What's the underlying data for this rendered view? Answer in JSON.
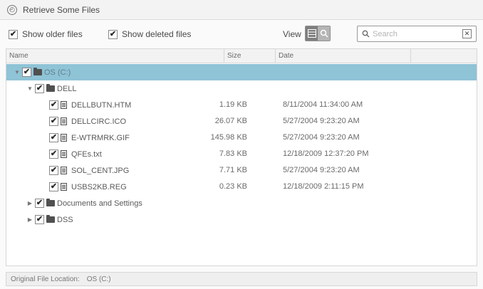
{
  "window": {
    "title": "Retrieve Some Files",
    "title_icon": "clock-icon"
  },
  "toolbar": {
    "show_older": {
      "label": "Show older files",
      "checked": true
    },
    "show_deleted": {
      "label": "Show deleted files",
      "checked": true
    },
    "view_label": "View",
    "view_modes": [
      {
        "name": "list-view-icon",
        "active": true
      },
      {
        "name": "search-view-icon",
        "active": false
      }
    ],
    "search": {
      "placeholder": "Search",
      "value": ""
    }
  },
  "table": {
    "columns": [
      "Name",
      "Size",
      "Date"
    ],
    "rows": [
      {
        "type": "drive",
        "name": "OS (C:)",
        "size": "",
        "date": "",
        "expanded": true,
        "checked": true,
        "selected": true,
        "depth": 0
      },
      {
        "type": "folder",
        "name": "DELL",
        "size": "",
        "date": "",
        "expanded": true,
        "checked": true,
        "selected": false,
        "depth": 1
      },
      {
        "type": "file",
        "name": "DELLBUTN.HTM",
        "size": "1.19 KB",
        "date": "8/11/2004 11:34:00 AM",
        "checked": true,
        "selected": false,
        "depth": 2
      },
      {
        "type": "file",
        "name": "DELLCIRC.ICO",
        "size": "26.07 KB",
        "date": "5/27/2004 9:23:20 AM",
        "checked": true,
        "selected": false,
        "depth": 2
      },
      {
        "type": "file",
        "name": "E-WTRMRK.GIF",
        "size": "145.98 KB",
        "date": "5/27/2004 9:23:20 AM",
        "checked": true,
        "selected": false,
        "depth": 2
      },
      {
        "type": "file",
        "name": "QFEs.txt",
        "size": "7.83 KB",
        "date": "12/18/2009 12:37:20 PM",
        "checked": true,
        "selected": false,
        "depth": 2
      },
      {
        "type": "file",
        "name": "SOL_CENT.JPG",
        "size": "7.71 KB",
        "date": "5/27/2004 9:23:20 AM",
        "checked": true,
        "selected": false,
        "depth": 2
      },
      {
        "type": "file",
        "name": "USBS2KB.REG",
        "size": "0.23 KB",
        "date": "12/18/2009 2:11:15 PM",
        "checked": true,
        "selected": false,
        "depth": 2
      },
      {
        "type": "folder",
        "name": "Documents and Settings",
        "size": "",
        "date": "",
        "expanded": false,
        "checked": true,
        "selected": false,
        "depth": 1
      },
      {
        "type": "folder",
        "name": "DSS",
        "size": "",
        "date": "",
        "expanded": false,
        "checked": true,
        "selected": false,
        "depth": 1
      }
    ]
  },
  "status_bar": {
    "label": "Original File Location:",
    "value": "OS (C:)"
  }
}
